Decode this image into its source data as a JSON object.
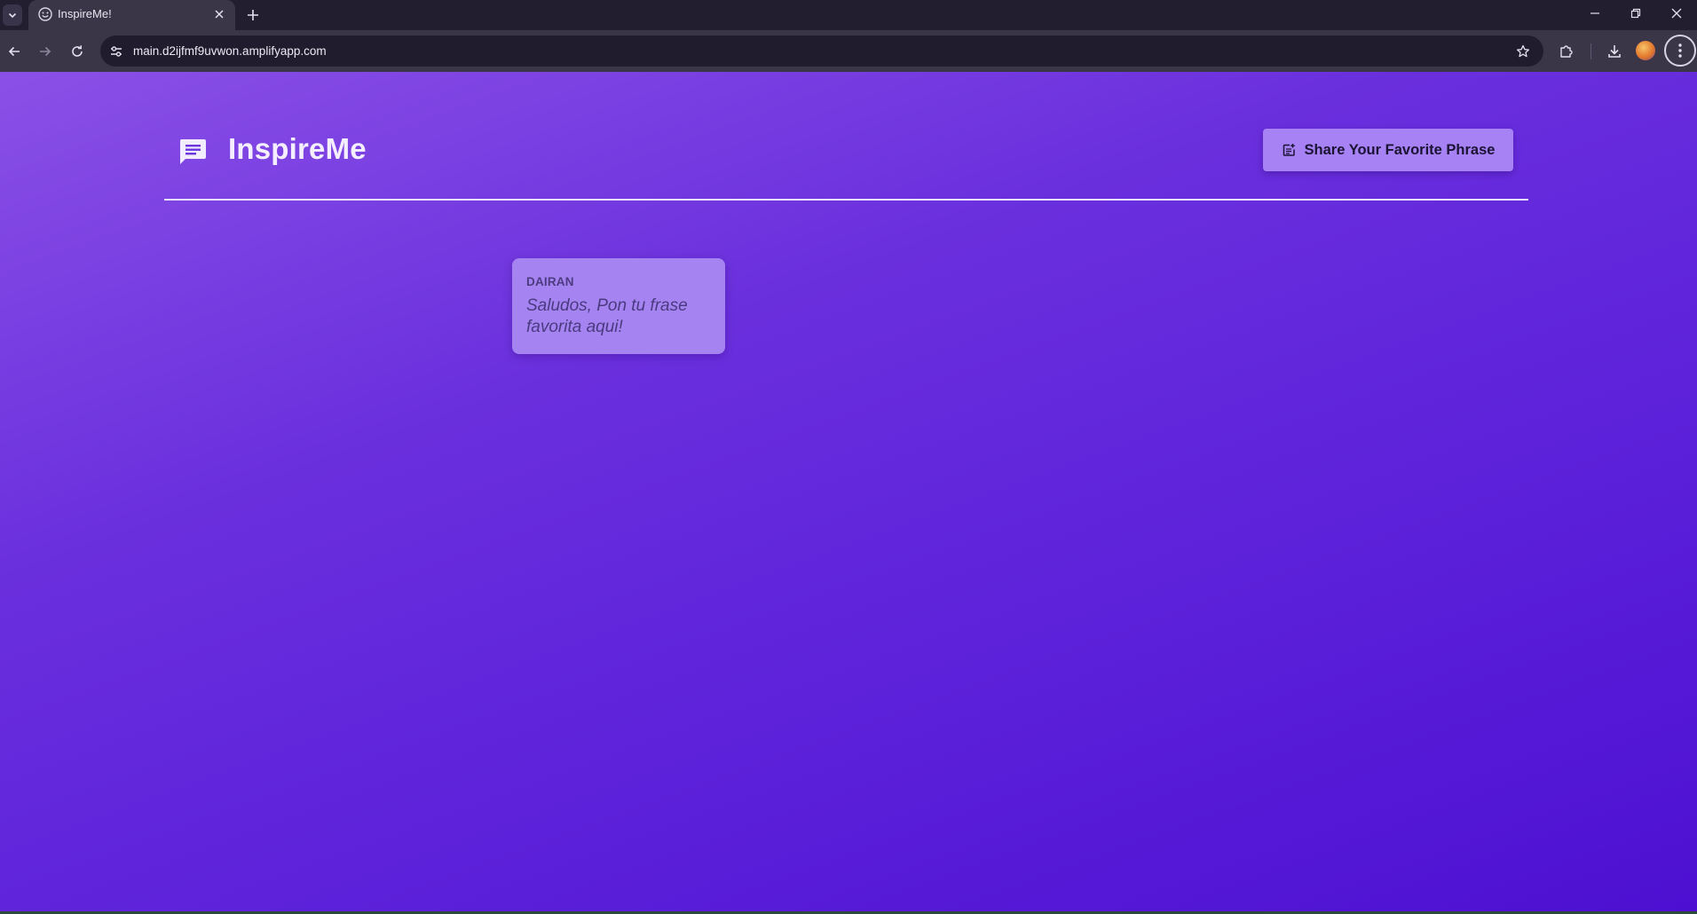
{
  "browser": {
    "tab_title": "InspireMe!",
    "url": "main.d2ijfmf9uvwon.amplifyapp.com"
  },
  "app": {
    "title": "InspireMe",
    "share_button_label": "Share Your Favorite Phrase"
  },
  "phrases": [
    {
      "author": "DAIRAN",
      "text": "Saludos, Pon tu frase favorita aqui!"
    }
  ],
  "colors": {
    "background_start": "#8a50e6",
    "background_end": "#4d10d2",
    "button": "#a682f5",
    "card": "#a584f2",
    "divider": "#e7defc"
  },
  "icons": {
    "logo": "chat-bubble-icon",
    "share_button": "post-add-icon"
  }
}
